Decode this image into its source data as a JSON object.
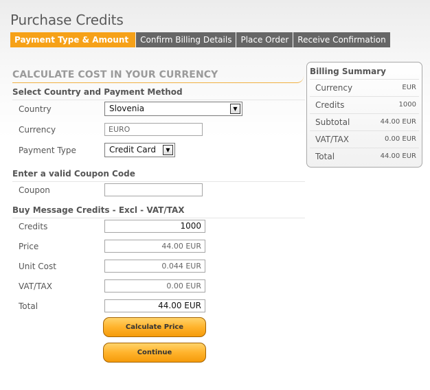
{
  "page": {
    "title": "Purchase Credits"
  },
  "steps": [
    {
      "label": "Payment Type & Amount",
      "active": true
    },
    {
      "label": "Confirm Billing Details",
      "active": false
    },
    {
      "label": "Place Order",
      "active": false
    },
    {
      "label": "Receive Confirmation",
      "active": false
    }
  ],
  "calc": {
    "heading": "CALCULATE COST IN YOUR CURRENCY",
    "country_section": "Select Country and Payment Method",
    "country_label": "Country",
    "country_value": "Slovenia",
    "currency_label": "Currency",
    "currency_value": "EURO",
    "payment_label": "Payment Type",
    "payment_value": "Credit Card"
  },
  "coupon": {
    "section": "Enter a valid Coupon Code",
    "label": "Coupon",
    "value": ""
  },
  "credits": {
    "section": "Buy Message Credits - Excl - VAT/TAX",
    "credits_label": "Credits",
    "credits_value": "1000",
    "price_label": "Price",
    "price_value": "44.00 EUR",
    "unit_label": "Unit Cost",
    "unit_value": "0.044 EUR",
    "vat_label": "VAT/TAX",
    "vat_value": "0.00 EUR",
    "total_label": "Total",
    "total_value": "44.00 EUR"
  },
  "buttons": {
    "calculate": "Calculate Price",
    "continue": "Continue"
  },
  "summary": {
    "title": "Billing Summary",
    "rows": [
      {
        "label": "Currency",
        "value": "EUR"
      },
      {
        "label": "Credits",
        "value": "1000"
      },
      {
        "label": "Subtotal",
        "value": "44.00 EUR"
      },
      {
        "label": "VAT/TAX",
        "value": "0.00 EUR"
      },
      {
        "label": "Total",
        "value": "44.00 EUR"
      }
    ]
  },
  "colors": {
    "accent": "#f6a118",
    "step_inactive": "#666666",
    "heading_gray": "#9a9a9a"
  }
}
